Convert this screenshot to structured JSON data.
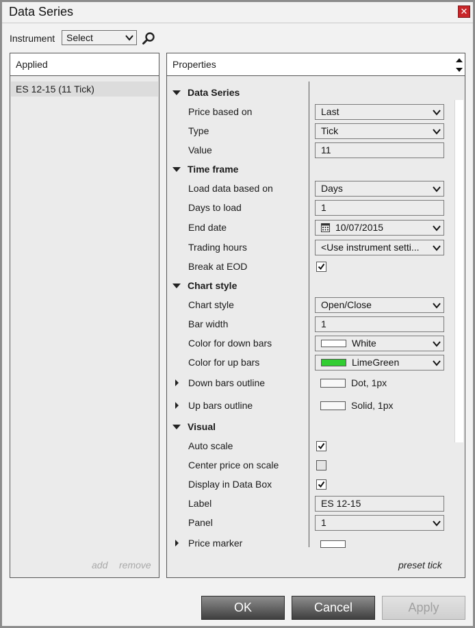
{
  "window": {
    "title": "Data Series",
    "close_glyph": "✕"
  },
  "instrument": {
    "label": "Instrument",
    "selected": "Select"
  },
  "applied": {
    "header": "Applied",
    "items": [
      "ES 12-15 (11 Tick)"
    ],
    "add_label": "add",
    "remove_label": "remove"
  },
  "properties": {
    "header": "Properties",
    "preset_label": "preset tick",
    "data_series": {
      "title": "Data Series",
      "price_based_on": {
        "label": "Price based on",
        "value": "Last"
      },
      "type": {
        "label": "Type",
        "value": "Tick"
      },
      "value": {
        "label": "Value",
        "value": "11"
      }
    },
    "time_frame": {
      "title": "Time frame",
      "load_data_based_on": {
        "label": "Load data based on",
        "value": "Days"
      },
      "days_to_load": {
        "label": "Days to load",
        "value": "1"
      },
      "end_date": {
        "label": "End date",
        "value": "10/07/2015"
      },
      "trading_hours": {
        "label": "Trading hours",
        "value": "<Use instrument setti..."
      },
      "break_at_eod": {
        "label": "Break at EOD",
        "checked": true
      }
    },
    "chart_style": {
      "title": "Chart style",
      "chart_style": {
        "label": "Chart style",
        "value": "Open/Close"
      },
      "bar_width": {
        "label": "Bar width",
        "value": "1"
      },
      "color_down": {
        "label": "Color for down bars",
        "value": "White",
        "color": "#ffffff"
      },
      "color_up": {
        "label": "Color for up bars",
        "value": "LimeGreen",
        "color": "#32cd32"
      },
      "down_outline": {
        "label": "Down bars outline",
        "value": "Dot, 1px"
      },
      "up_outline": {
        "label": "Up bars outline",
        "value": "Solid, 1px"
      }
    },
    "visual": {
      "title": "Visual",
      "auto_scale": {
        "label": "Auto scale",
        "checked": true
      },
      "center_price": {
        "label": "Center price on scale",
        "checked": false
      },
      "display_data_box": {
        "label": "Display in Data Box",
        "checked": true
      },
      "label": {
        "label": "Label",
        "value": "ES 12-15"
      },
      "panel": {
        "label": "Panel",
        "value": "1"
      },
      "price_marker": {
        "label": "Price marker"
      }
    }
  },
  "buttons": {
    "ok": "OK",
    "cancel": "Cancel",
    "apply": "Apply"
  }
}
